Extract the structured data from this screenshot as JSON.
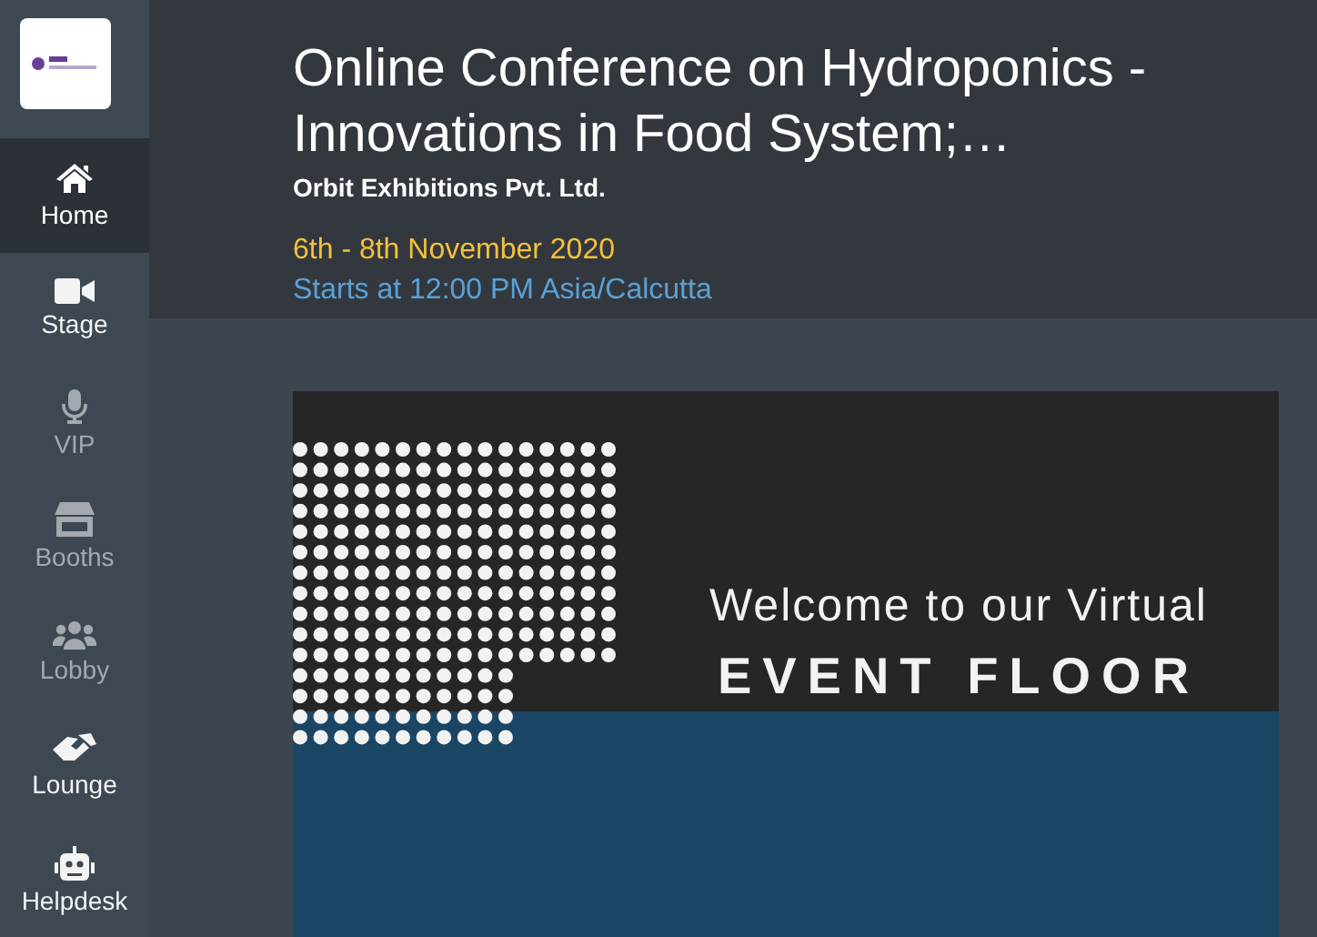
{
  "sidebar": {
    "items": [
      {
        "kind": "home",
        "label": "Home",
        "selected": true,
        "disabled": false
      },
      {
        "kind": "stage",
        "label": "Stage",
        "selected": false,
        "disabled": false
      },
      {
        "kind": "vip",
        "label": "VIP",
        "selected": false,
        "disabled": true
      },
      {
        "kind": "booths",
        "label": "Booths",
        "selected": false,
        "disabled": true
      },
      {
        "kind": "lobby",
        "label": "Lobby",
        "selected": false,
        "disabled": true
      },
      {
        "kind": "lounge",
        "label": "Lounge",
        "selected": false,
        "disabled": false
      },
      {
        "kind": "helpdesk",
        "label": "Helpdesk",
        "selected": false,
        "disabled": false
      }
    ]
  },
  "event": {
    "title": "Online Conference on Hydroponics - Innovations in Food System;…",
    "organizer": "Orbit Exhibitions Pvt. Ltd.",
    "dates": "6th - 8th November 2020",
    "start": "Starts at 12:00 PM Asia/Calcutta"
  },
  "banner": {
    "line_1": "Welcome to our Virtual",
    "line_2": "EVENT FLOOR"
  }
}
